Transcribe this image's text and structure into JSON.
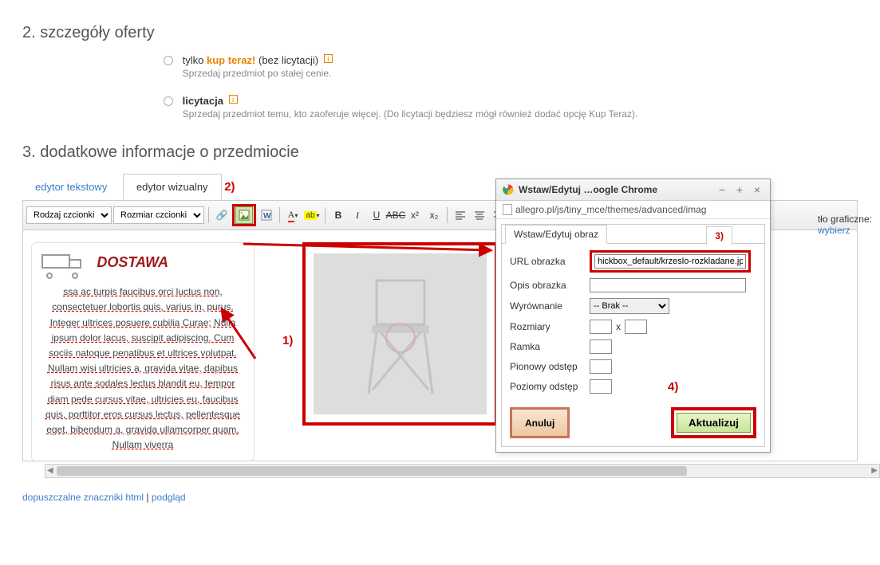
{
  "section2": {
    "title": "2. szczegóły oferty",
    "opt1_prefix": "tylko ",
    "opt1_strong": "kup teraz!",
    "opt1_suffix": " (bez licytacji)",
    "opt1_sub": "Sprzedaj przedmiot po stałej cenie.",
    "opt2_label": "licytacja",
    "opt2_sub": "Sprzedaj przedmiot temu, kto zaoferuje więcej. (Do licytacji będziesz mógł również dodać opcję Kup Teraz)."
  },
  "section3": {
    "title": "3. dodatkowe informacje o przedmiocie",
    "tab_text": "edytor tekstowy",
    "tab_visual": "edytor wizualny"
  },
  "toolbar": {
    "font_family": "Rodzaj czcionki",
    "font_size": "Rozmiar czcionki"
  },
  "editor": {
    "dostawa": "DOSTAWA",
    "lorem": "ssa ac turpis faucibus orci luctus non, consectetuer lobortis quis, varius in, purus. Integer ultrices posuere cubilia Curae; Nulla ipsum dolor lacus, suscipit adipiscing. Cum sociis natoque penatibus et ultrices volutpat. Nullam wisi ultricies a, gravida vitae, dapibus risus ante sodales lectus blandit eu, tempor diam pede cursus vitae, ultricies eu, faucibus quis, porttitor eros cursus lectus, pellentesque eget, bibendum a, gravida ullamcorper quam. Nullam viverra"
  },
  "markers": {
    "m1": "1)",
    "m2": "2)",
    "m3": "3)",
    "m4": "4)"
  },
  "links": {
    "allowed": "dopuszczalne znaczniki html",
    "preview": "podgląd",
    "sep": " | "
  },
  "sidebar": {
    "bg_label": "tło graficzne:",
    "choose": "wybierz"
  },
  "popup": {
    "title": "Wstaw/Edytuj …oogle Chrome",
    "url": "allegro.pl/js/tiny_mce/themes/advanced/imag",
    "tab": "Wstaw/Edytuj obraz",
    "f": {
      "url_label": "URL obrazka",
      "url_value": "hickbox_default/krzeslo-rozkladane.jpg",
      "desc_label": "Opis obrazka",
      "desc_value": "",
      "align_label": "Wyrównanie",
      "align_value": "-- Brak --",
      "dims_label": "Rozmiary",
      "dims_x": "x",
      "border_label": "Ramka",
      "vpad_label": "Pionowy odstęp",
      "hpad_label": "Poziomy odstęp"
    },
    "cancel": "Anuluj",
    "update": "Aktualizuj"
  }
}
